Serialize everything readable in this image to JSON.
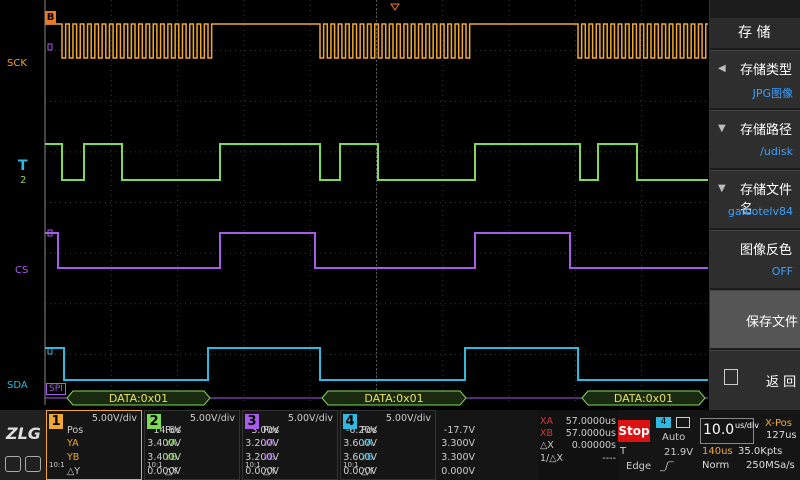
{
  "screen": {
    "trigger_marker": "B",
    "channel_labels": {
      "ch1": "SCK",
      "ch2": "2",
      "ch3": "CS",
      "ch4": "SDA",
      "trigger": "T"
    },
    "decode_label": "SPI",
    "decode_packets": [
      "DATA:0x01",
      "DATA:0x01",
      "DATA:0x01"
    ],
    "colors": {
      "ch1": "#f0a830",
      "ch2": "#7ed957",
      "ch3": "#a65ce8",
      "ch4": "#2fb8e0",
      "grid": "#3a3a3a"
    }
  },
  "menu": {
    "title": "存 储",
    "items": [
      {
        "label": "存储类型",
        "value": "JPG图像",
        "icon": "chevron-left-icon"
      },
      {
        "label": "存储路径",
        "value": "/udisk",
        "icon": "chevron-down-icon"
      },
      {
        "label": "存储文件名",
        "value": "gaibotelv84",
        "icon": "chevron-down-icon"
      },
      {
        "label": "图像反色",
        "value": "OFF",
        "icon": ""
      },
      {
        "label": "保存文件",
        "value": "",
        "icon": ""
      },
      {
        "label": "返 回",
        "value": "",
        "icon": "return-icon"
      }
    ]
  },
  "bottom": {
    "channels": [
      {
        "num": "1",
        "div": "5.00V/div",
        "pos_label": "Pos",
        "pos": "14.6V",
        "ya_label": "YA",
        "ya": "3.400V",
        "yb_label": "YB",
        "yb": "3.400V",
        "dy_label": "△Y",
        "dy": "0.000V",
        "probe": "10:1",
        "color": "#f0a830"
      },
      {
        "num": "2",
        "div": "5.00V/div",
        "pos_label": "Pos",
        "pos": "3.00V",
        "ya_label": "YA",
        "ya": "3.200V",
        "yb_label": "YB",
        "yb": "3.200V",
        "dy_label": "△Y",
        "dy": "0.000V",
        "probe": "10:1",
        "color": "#7ed957"
      },
      {
        "num": "3",
        "div": "5.00V/div",
        "pos_label": "Pos",
        "pos": "-6.20V",
        "ya_label": "YA",
        "ya": "3.600V",
        "yb_label": "YB",
        "yb": "3.600V",
        "dy_label": "△Y",
        "dy": "0.000V",
        "probe": "10:1",
        "color": "#a65ce8"
      },
      {
        "num": "4",
        "div": "5.00V/div",
        "pos_label": "Pos",
        "pos": "-17.7V",
        "ya_label": "YA",
        "ya": "3.300V",
        "yb_label": "YB",
        "yb": "3.300V",
        "dy_label": "△Y",
        "dy": "0.000V",
        "probe": "10:1",
        "color": "#2fb8e0"
      }
    ],
    "cursor": {
      "xa_label": "XA",
      "xa": "57.0000us",
      "xb_label": "XB",
      "xb": "57.0000us",
      "dx_label": "△X",
      "dx": "0.00000s",
      "inv_label": "1/△X",
      "inv": "----"
    },
    "run_state": "Stop",
    "trigger": {
      "source": "4",
      "mode": "Auto",
      "t_label": "T",
      "level": "21.9V",
      "type": "Edge"
    },
    "timebase": {
      "value": "10.0",
      "unit": "us/div",
      "xpos_label": "X-Pos",
      "xpos": "127us",
      "mem": "140us",
      "pts": "35.0Kpts",
      "acq": "Norm",
      "rate": "250MSa/s"
    }
  }
}
